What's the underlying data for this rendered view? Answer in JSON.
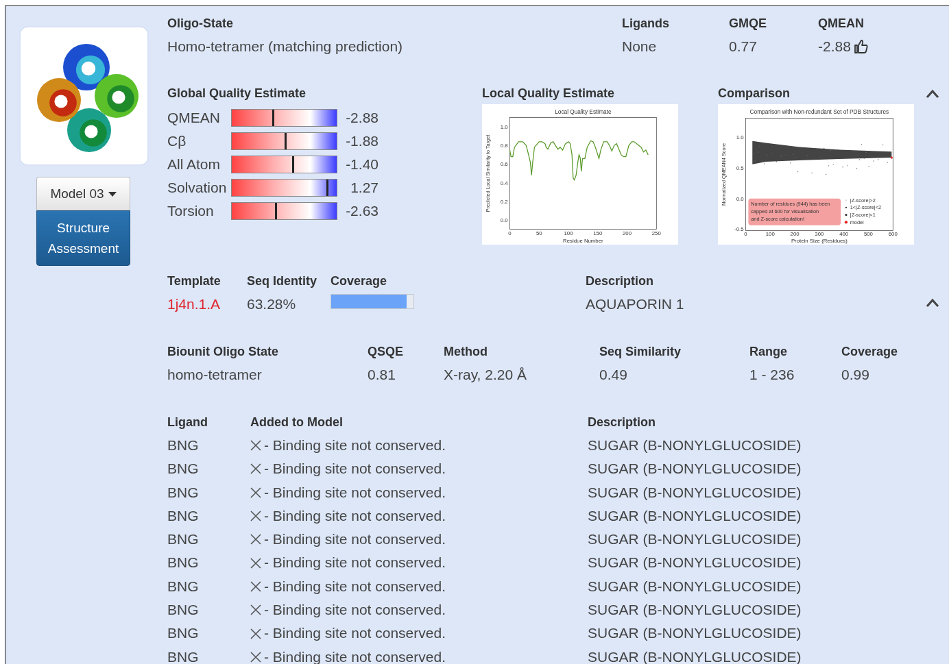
{
  "model_panel": {
    "model_dropdown": "Model 03",
    "assessment_button": "Structure Assessment"
  },
  "summary": {
    "fields": [
      {
        "label": "Oligo-State",
        "value": "Homo-tetramer (matching prediction)",
        "thumbs_up": false
      },
      {
        "label": "Ligands",
        "value": "None",
        "thumbs_up": false
      },
      {
        "label": "GMQE",
        "value": "0.77",
        "thumbs_up": false
      },
      {
        "label": "QMEAN",
        "value": "-2.88",
        "thumbs_up": true
      }
    ]
  },
  "quality": {
    "expanded": true,
    "global": {
      "title": "Global Quality Estimate",
      "rows": [
        {
          "name": "QMEAN",
          "level": 0.39,
          "reading": "-2.88"
        },
        {
          "name": "Cβ",
          "level": 0.51,
          "reading": "-1.88"
        },
        {
          "name": "All Atom",
          "level": 0.58,
          "reading": "-1.40"
        },
        {
          "name": "Solvation",
          "level": 0.91,
          "reading": "1.27"
        },
        {
          "name": "Torsion",
          "level": 0.42,
          "reading": "-2.63"
        }
      ]
    },
    "local": {
      "title": "Local Quality Estimate",
      "chart_data": {
        "type": "line",
        "title": "Local Quality Estimate",
        "xlabel": "Residue Number",
        "ylabel": "Predicted Local Similarity to Target",
        "x": [
          0,
          2,
          5,
          8,
          15,
          22,
          28,
          32,
          35,
          37,
          39,
          42,
          50,
          55,
          60,
          62,
          65,
          70,
          74,
          78,
          82,
          86,
          90,
          95,
          100,
          103,
          106,
          108,
          110,
          113,
          116,
          118,
          120,
          122,
          124,
          128,
          132,
          138,
          142,
          146,
          150,
          152,
          155,
          160,
          166,
          170,
          174,
          178,
          182,
          186,
          190,
          194,
          198,
          203,
          208,
          212,
          216,
          220,
          224,
          228,
          232,
          236
        ],
        "series": [
          {
            "color": "#5a9a2a",
            "values": [
              0.75,
              0.68,
              0.68,
              0.78,
              0.84,
              0.84,
              0.8,
              0.7,
              0.62,
              0.48,
              0.62,
              0.78,
              0.84,
              0.84,
              0.82,
              0.78,
              0.76,
              0.83,
              0.84,
              0.8,
              0.76,
              0.78,
              0.75,
              0.82,
              0.84,
              0.82,
              0.7,
              0.45,
              0.43,
              0.48,
              0.62,
              0.7,
              0.67,
              0.52,
              0.66,
              0.66,
              0.78,
              0.85,
              0.84,
              0.78,
              0.7,
              0.66,
              0.75,
              0.84,
              0.84,
              0.8,
              0.74,
              0.8,
              0.82,
              0.76,
              0.7,
              0.68,
              0.68,
              0.8,
              0.84,
              0.84,
              0.82,
              0.8,
              0.78,
              0.73,
              0.75,
              0.7
            ]
          }
        ],
        "xlim": [
          0,
          250
        ],
        "ylim": [
          -0.1,
          1.1
        ],
        "xticks": [
          0,
          50,
          100,
          150,
          200,
          250
        ],
        "yticks": [
          {
            "value": 0,
            "label": "0.0"
          },
          {
            "value": 0.2,
            "label": "0.2"
          },
          {
            "value": 0.4,
            "label": "0.4"
          },
          {
            "value": 0.6,
            "label": "0.6"
          },
          {
            "value": 0.8,
            "label": "0.8"
          },
          {
            "value": 1,
            "label": "1.0"
          }
        ]
      }
    },
    "comparison": {
      "title": "Comparison",
      "plot": {
        "title": "Comparison with Non-redundant Set of PDB Structures",
        "xlabel": "Protein Size (Residues)",
        "ylabel": "Normalized QMEAN4 Score",
        "xticks": [
          "0",
          "100",
          "200",
          "300",
          "400",
          "500",
          "600"
        ],
        "yticks": [
          "1.0",
          "0.5",
          "0.0",
          "-0.5"
        ],
        "legend": [
          "|Z-score|>2",
          "1<|Z-score|<2",
          "|Z-score|<1",
          "model"
        ],
        "note": [
          "Number of residues (944) has been",
          "capped at 600 for visualisation",
          "and Z-score calculation!"
        ]
      }
    }
  },
  "template": {
    "expanded": true,
    "columns": [
      "Template",
      "Seq Identity",
      "Coverage",
      "Description"
    ],
    "template": "1j4n.1.A",
    "seq_identity": "63.28%",
    "coverage": {
      "level": 0.92
    },
    "description": "AQUAPORIN 1"
  },
  "biounit": {
    "fields": [
      {
        "label": "Biounit Oligo State",
        "value": "homo-tetramer"
      },
      {
        "label": "QSQE",
        "value": "0.81"
      },
      {
        "label": "Method",
        "value": "X-ray, 2.20 Å"
      },
      {
        "label": "Seq Similarity",
        "value": "0.49"
      },
      {
        "label": "Range",
        "value": "1 - 236"
      },
      {
        "label": "Coverage",
        "value": "0.99"
      }
    ]
  },
  "ligands": {
    "columns": [
      "Ligand",
      "Added to Model",
      "Description"
    ],
    "rows": [
      {
        "ligand": "BNG",
        "conserved": false,
        "added": "- Binding site not conserved.",
        "description": "SUGAR (B-NONYLGLUCOSIDE)"
      },
      {
        "ligand": "BNG",
        "conserved": false,
        "added": "- Binding site not conserved.",
        "description": "SUGAR (B-NONYLGLUCOSIDE)"
      },
      {
        "ligand": "BNG",
        "conserved": false,
        "added": "- Binding site not conserved.",
        "description": "SUGAR (B-NONYLGLUCOSIDE)"
      },
      {
        "ligand": "BNG",
        "conserved": false,
        "added": "- Binding site not conserved.",
        "description": "SUGAR (B-NONYLGLUCOSIDE)"
      },
      {
        "ligand": "BNG",
        "conserved": false,
        "added": "- Binding site not conserved.",
        "description": "SUGAR (B-NONYLGLUCOSIDE)"
      },
      {
        "ligand": "BNG",
        "conserved": false,
        "added": "- Binding site not conserved.",
        "description": "SUGAR (B-NONYLGLUCOSIDE)"
      },
      {
        "ligand": "BNG",
        "conserved": false,
        "added": "- Binding site not conserved.",
        "description": "SUGAR (B-NONYLGLUCOSIDE)"
      },
      {
        "ligand": "BNG",
        "conserved": false,
        "added": "- Binding site not conserved.",
        "description": "SUGAR (B-NONYLGLUCOSIDE)"
      },
      {
        "ligand": "BNG",
        "conserved": false,
        "added": "- Binding site not conserved.",
        "description": "SUGAR (B-NONYLGLUCOSIDE)"
      },
      {
        "ligand": "BNG",
        "conserved": false,
        "added": "- Binding site not conserved.",
        "description": "SUGAR (B-NONYLGLUCOSIDE)"
      }
    ]
  }
}
